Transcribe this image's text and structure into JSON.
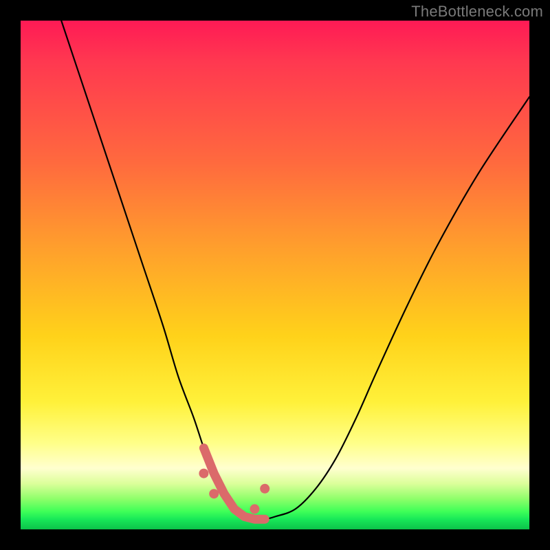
{
  "watermark": "TheBottleneck.com",
  "chart_data": {
    "type": "line",
    "title": "",
    "xlabel": "",
    "ylabel": "",
    "xlim": [
      0,
      100
    ],
    "ylim": [
      0,
      100
    ],
    "grid": false,
    "series": [
      {
        "name": "bottleneck-curve",
        "x": [
          8,
          12,
          16,
          20,
          24,
          28,
          31,
          34,
          36,
          38,
          40,
          42,
          44,
          46,
          48,
          50,
          54,
          58,
          62,
          66,
          70,
          76,
          82,
          90,
          100
        ],
        "y": [
          100,
          88,
          76,
          64,
          52,
          40,
          30,
          22,
          16,
          11,
          7,
          4,
          2.5,
          2,
          2,
          2.5,
          4,
          8,
          14,
          22,
          31,
          44,
          56,
          70,
          85
        ]
      }
    ],
    "annotations": [
      {
        "name": "pink-marker-cluster",
        "approx_x_range": [
          36,
          48
        ],
        "approx_y_range": [
          2,
          11
        ]
      }
    ],
    "colors": {
      "curve": "#000000",
      "markers": "#db6a6a",
      "gradient_top": "#ff1a55",
      "gradient_mid": "#ffe23a",
      "gradient_bottom": "#18e858"
    }
  }
}
